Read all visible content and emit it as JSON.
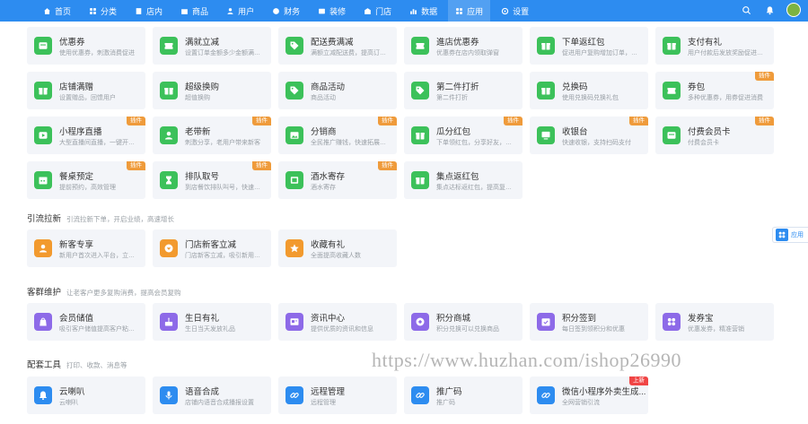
{
  "nav": [
    {
      "label": "首页",
      "icon": "home-icon"
    },
    {
      "label": "分类",
      "icon": "category-icon"
    },
    {
      "label": "店内",
      "icon": "store-icon"
    },
    {
      "label": "商品",
      "icon": "goods-icon"
    },
    {
      "label": "用户",
      "icon": "user-icon"
    },
    {
      "label": "财务",
      "icon": "finance-icon"
    },
    {
      "label": "装修",
      "icon": "decorate-icon"
    },
    {
      "label": "门店",
      "icon": "shop-icon"
    },
    {
      "label": "数据",
      "icon": "data-icon"
    },
    {
      "label": "应用",
      "icon": "apps-icon",
      "active": true
    },
    {
      "label": "设置",
      "icon": "settings-icon"
    }
  ],
  "marketing_cards": [
    {
      "title": "优惠券",
      "desc": "使用优惠券，刺激消费促进",
      "color": "#3cc15a",
      "badge": ""
    },
    {
      "title": "满就立减",
      "desc": "设置订单金额多少金额满额促进",
      "color": "#3cc15a",
      "badge": ""
    },
    {
      "title": "配送费满减",
      "desc": "满额立减配送费，提高订单成交",
      "color": "#3cc15a",
      "badge": ""
    },
    {
      "title": "進店优惠券",
      "desc": "优惠券在店内领取弹窗",
      "color": "#3cc15a",
      "badge": ""
    },
    {
      "title": "下单返红包",
      "desc": "促进用户复购增加订单，提升",
      "color": "#3cc15a",
      "badge": ""
    },
    {
      "title": "支付有礼",
      "desc": "用户付款后发放奖励促进消费",
      "color": "#3cc15a",
      "badge": ""
    },
    {
      "title": "店铺满赠",
      "desc": "设置赠品，回馈用户",
      "color": "#3cc15a",
      "badge": ""
    },
    {
      "title": "超级换购",
      "desc": "超值换购",
      "color": "#3cc15a",
      "badge": ""
    },
    {
      "title": "商品活动",
      "desc": "商品活动",
      "color": "#3cc15a",
      "badge": ""
    },
    {
      "title": "第二件打折",
      "desc": "第二件打折",
      "color": "#3cc15a",
      "badge": ""
    },
    {
      "title": "兑换码",
      "desc": "使用兑换码兑换礼包",
      "color": "#3cc15a",
      "badge": ""
    },
    {
      "title": "券包",
      "desc": "多种优惠券，用券促进消费",
      "color": "#3cc15a",
      "badge": "插件"
    },
    {
      "title": "小程序直播",
      "desc": "大型直播间直播，一键开启直播",
      "color": "#3cc15a",
      "badge": "插件"
    },
    {
      "title": "老带新",
      "desc": "刺激分享，老用户带来新客",
      "color": "#3cc15a",
      "badge": "插件"
    },
    {
      "title": "分销商",
      "desc": "全民推广赚钱，快速拓展渠道",
      "color": "#3cc15a",
      "badge": "插件"
    },
    {
      "title": "瓜分红包",
      "desc": "下单领红包，分享好友，邀人",
      "color": "#3cc15a",
      "badge": "插件"
    },
    {
      "title": "收银台",
      "desc": "快速收银，支持扫码支付",
      "color": "#3cc15a",
      "badge": "插件"
    },
    {
      "title": "付费会员卡",
      "desc": "付费会员卡",
      "color": "#3cc15a",
      "badge": "插件"
    },
    {
      "title": "餐桌预定",
      "desc": "提前预约，高效管理",
      "color": "#3cc15a",
      "badge": "插件"
    },
    {
      "title": "排队取号",
      "desc": "到店餐饮排队叫号，快速分桌",
      "color": "#3cc15a",
      "badge": "插件"
    },
    {
      "title": "酒水寄存",
      "desc": "酒水寄存",
      "color": "#3cc15a",
      "badge": "插件"
    },
    {
      "title": "集点返红包",
      "desc": "集点达标返红包，提高复购率",
      "color": "#3cc15a",
      "badge": ""
    }
  ],
  "section_traffic": {
    "title": "引流拉新",
    "sub": "引流拉新下单，开启业绩，高速增长"
  },
  "traffic_cards": [
    {
      "title": "新客专享",
      "desc": "新用户首次进入平台，立享好礼",
      "color": "#f29a2e"
    },
    {
      "title": "门店新客立减",
      "desc": "门店新客立减，吸引新用户下单",
      "color": "#f29a2e"
    },
    {
      "title": "收藏有礼",
      "desc": "全面提高收藏人数",
      "color": "#f29a2e"
    }
  ],
  "section_retention": {
    "title": "客群维护",
    "sub": "让老客户更多复购消费，提高会员复购"
  },
  "retention_cards": [
    {
      "title": "会员储值",
      "desc": "吸引客户储值提高客户粘性和",
      "color": "#8d6ae8"
    },
    {
      "title": "生日有礼",
      "desc": "生日当天发放礼品",
      "color": "#8d6ae8"
    },
    {
      "title": "资讯中心",
      "desc": "提供优质的资讯和信息",
      "color": "#8d6ae8"
    },
    {
      "title": "积分商城",
      "desc": "积分兑换可以兑换商品",
      "color": "#8d6ae8"
    },
    {
      "title": "积分签到",
      "desc": "每日签到领积分和优惠",
      "color": "#8d6ae8"
    },
    {
      "title": "发券宝",
      "desc": "优惠发券，精准营销",
      "color": "#8d6ae8"
    }
  ],
  "section_tools": {
    "title": "配套工具",
    "sub": "打印、收款、消息等"
  },
  "tool_cards": [
    {
      "title": "云喇叭",
      "desc": "云喇叭",
      "color": "#2d8cf0",
      "badge": ""
    },
    {
      "title": "语音合成",
      "desc": "店铺内语音合成播报设置",
      "color": "#2d8cf0",
      "badge": ""
    },
    {
      "title": "远程管理",
      "desc": "远程管理",
      "color": "#2d8cf0",
      "badge": ""
    },
    {
      "title": "推广码",
      "desc": "推广码",
      "color": "#2d8cf0",
      "badge": ""
    },
    {
      "title": "微信小程序外卖生成...",
      "desc": "全网营销引流",
      "color": "#2d8cf0",
      "badge": "上新"
    }
  ],
  "side_float": {
    "label": "应用"
  },
  "watermark": "https://www.huzhan.com/ishop26990"
}
